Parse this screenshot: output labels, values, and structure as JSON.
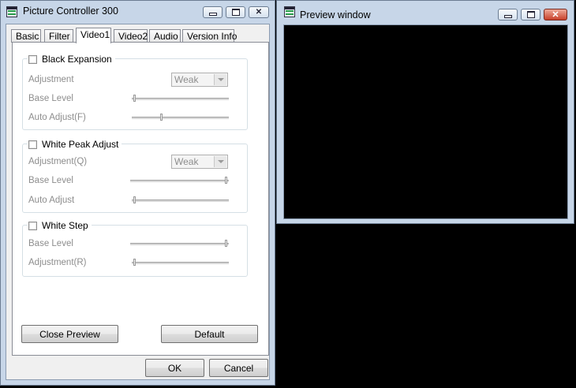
{
  "main_window": {
    "title": "Picture Controller 300",
    "tabs": [
      {
        "label": "Basic"
      },
      {
        "label": "Filter"
      },
      {
        "label": "Video1",
        "active": true
      },
      {
        "label": "Video2"
      },
      {
        "label": "Audio"
      },
      {
        "label": "Version Info"
      }
    ],
    "groups": {
      "black_expansion": {
        "title": "Black Expansion",
        "checked": false,
        "adjustment_label": "Adjustment",
        "adjustment_value": "Weak",
        "base_level_label": "Base Level",
        "base_level_value": 0.02,
        "auto_adjust_label": "Auto Adjust(F)",
        "auto_adjust_value": 0.3
      },
      "white_peak_adjust": {
        "title": "White Peak Adjust",
        "checked": false,
        "adjustment_label": "Adjustment(Q)",
        "adjustment_value": "Weak",
        "base_level_label": "Base Level",
        "base_level_value": 0.98,
        "auto_adjust_label": "Auto Adjust",
        "auto_adjust_value": 0.02
      },
      "white_step": {
        "title": "White Step",
        "checked": false,
        "base_level_label": "Base Level",
        "base_level_value": 0.98,
        "adjustment_label": "Adjustment(R)",
        "adjustment_value": 0.02
      }
    },
    "close_preview_label": "Close Preview",
    "default_label": "Default",
    "ok_label": "OK",
    "cancel_label": "Cancel"
  },
  "preview_window": {
    "title": "Preview window"
  },
  "icons": {
    "app": "app-icon",
    "minimize": "minimize-icon",
    "maximize": "maximize-icon",
    "close": "close-icon",
    "dropdown": "chevron-down-icon"
  },
  "colors": {
    "titlebar": "#c7d6e8",
    "close_button": "#c8402a",
    "preview_background": "#000000",
    "disabled_text": "#8d8d8d"
  }
}
